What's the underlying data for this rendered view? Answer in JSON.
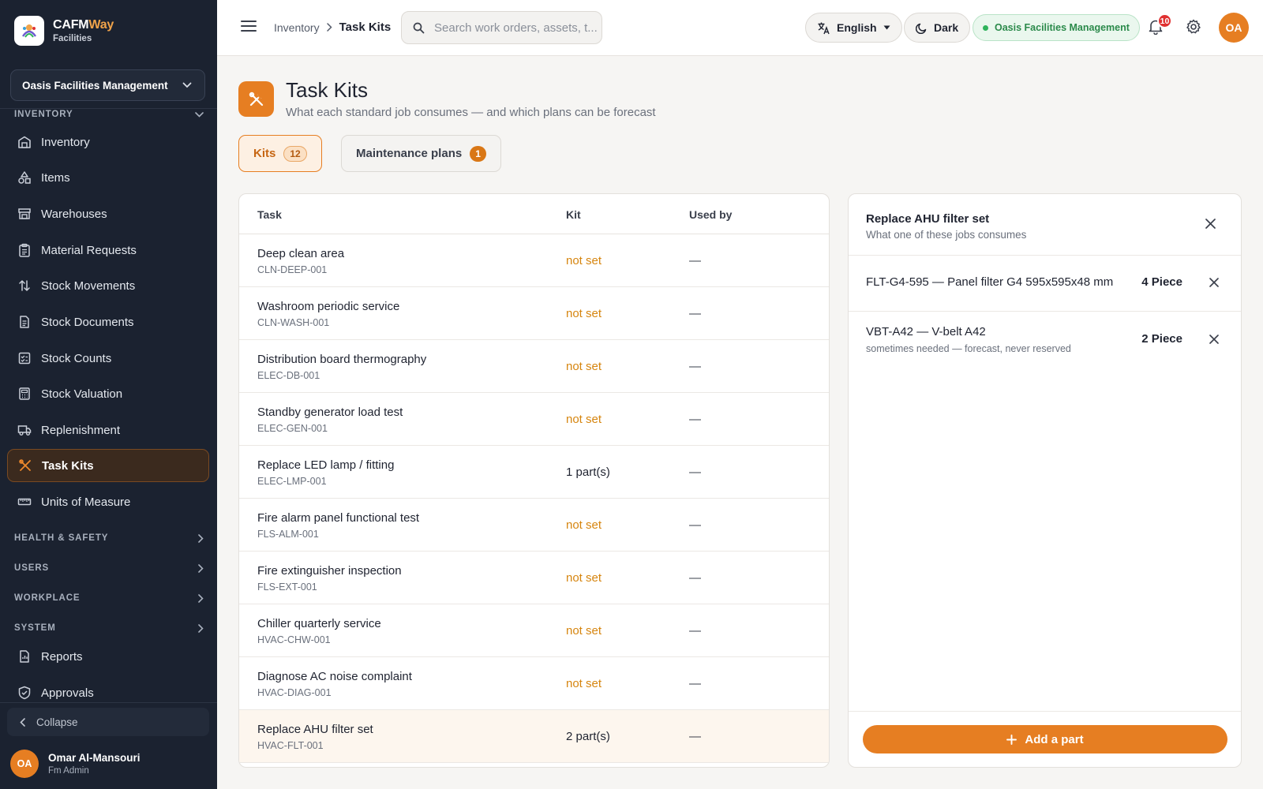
{
  "brand": {
    "name_a": "CAFM",
    "name_b": "Way",
    "subtitle": "Facilities",
    "accent": "#e67e22"
  },
  "sidebar": {
    "org_selector": "Oasis Facilities Management",
    "section_inventory": "INVENTORY",
    "items": [
      {
        "label": "Inventory",
        "icon": "warehouse-icon"
      },
      {
        "label": "Items",
        "icon": "shapes-icon"
      },
      {
        "label": "Warehouses",
        "icon": "store-icon"
      },
      {
        "label": "Material Requests",
        "icon": "clipboard-icon"
      },
      {
        "label": "Stock Movements",
        "icon": "arrows-updown-icon"
      },
      {
        "label": "Stock Documents",
        "icon": "document-icon"
      },
      {
        "label": "Stock Counts",
        "icon": "checklist-icon"
      },
      {
        "label": "Stock Valuation",
        "icon": "calculator-icon"
      },
      {
        "label": "Replenishment",
        "icon": "truck-icon"
      },
      {
        "label": "Task Kits",
        "icon": "tools-icon",
        "active": true
      },
      {
        "label": "Units of Measure",
        "icon": "ruler-icon"
      }
    ],
    "sections": [
      "HEALTH & SAFETY",
      "USERS",
      "WORKPLACE",
      "SYSTEM"
    ],
    "extra_items": [
      {
        "label": "Reports",
        "icon": "report-icon"
      },
      {
        "label": "Approvals",
        "icon": "shield-check-icon"
      }
    ],
    "collapse_label": "Collapse",
    "user": {
      "initials": "OA",
      "name": "Omar Al-Mansouri",
      "role": "Fm Admin"
    }
  },
  "topbar": {
    "breadcrumb_parent": "Inventory",
    "breadcrumb_current": "Task Kits",
    "search_placeholder": "Search work orders, assets, t...",
    "language": "English",
    "theme": "Dark",
    "org_status": "Oasis Facilities Management",
    "notification_count": "10",
    "user_initials": "OA"
  },
  "page": {
    "title": "Task Kits",
    "subtitle": "What each standard job consumes — and which plans can be forecast",
    "tabs": [
      {
        "label": "Kits",
        "count": "12",
        "active": true
      },
      {
        "label": "Maintenance plans",
        "count": "1",
        "active": false
      }
    ]
  },
  "table": {
    "headers": {
      "task": "Task",
      "kit": "Kit",
      "used_by": "Used by"
    },
    "rows": [
      {
        "name": "Deep clean area",
        "code": "CLN-DEEP-001",
        "kit": "not set",
        "used_by": "—"
      },
      {
        "name": "Washroom periodic service",
        "code": "CLN-WASH-001",
        "kit": "not set",
        "used_by": "—"
      },
      {
        "name": "Distribution board thermography",
        "code": "ELEC-DB-001",
        "kit": "not set",
        "used_by": "—"
      },
      {
        "name": "Standby generator load test",
        "code": "ELEC-GEN-001",
        "kit": "not set",
        "used_by": "—"
      },
      {
        "name": "Replace LED lamp / fitting",
        "code": "ELEC-LMP-001",
        "kit": "1 part(s)",
        "used_by": "—"
      },
      {
        "name": "Fire alarm panel functional test",
        "code": "FLS-ALM-001",
        "kit": "not set",
        "used_by": "—"
      },
      {
        "name": "Fire extinguisher inspection",
        "code": "FLS-EXT-001",
        "kit": "not set",
        "used_by": "—"
      },
      {
        "name": "Chiller quarterly service",
        "code": "HVAC-CHW-001",
        "kit": "not set",
        "used_by": "—"
      },
      {
        "name": "Diagnose AC noise complaint",
        "code": "HVAC-DIAG-001",
        "kit": "not set",
        "used_by": "—"
      },
      {
        "name": "Replace AHU filter set",
        "code": "HVAC-FLT-001",
        "kit": "2 part(s)",
        "used_by": "—",
        "selected": true
      }
    ]
  },
  "detail": {
    "title": "Replace AHU filter set",
    "subtitle": "What one of these jobs consumes",
    "parts": [
      {
        "name": "FLT-G4-595 — Panel filter G4 595x595x48 mm",
        "note": "",
        "qty": "4 Piece"
      },
      {
        "name": "VBT-A42 — V-belt A42",
        "note": "sometimes needed — forecast, never reserved",
        "qty": "2 Piece"
      }
    ],
    "add_button": "Add a part"
  }
}
